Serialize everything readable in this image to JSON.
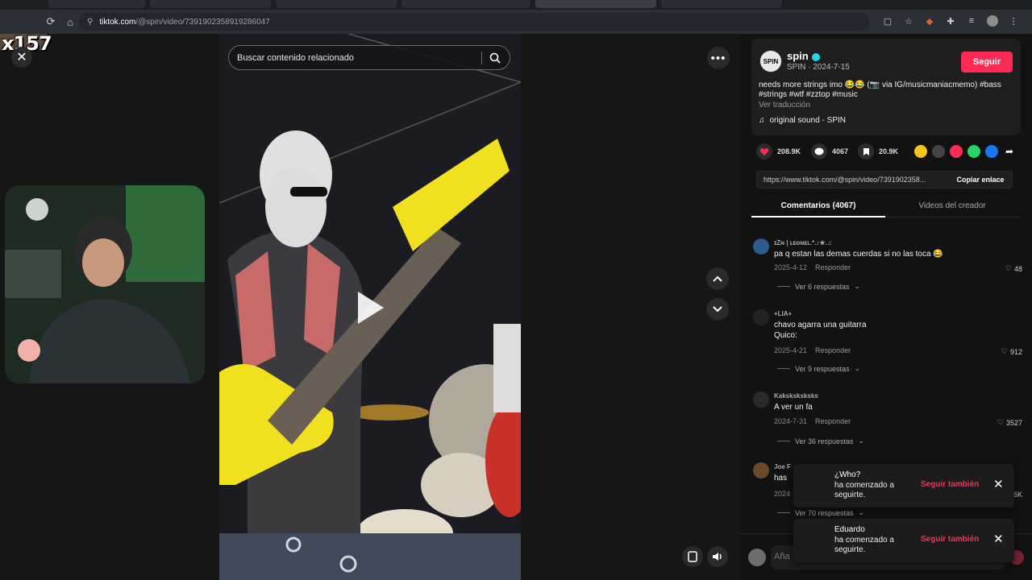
{
  "browser": {
    "url_host": "tiktok.com",
    "url_path": "/@spin/video/7391902358919286047"
  },
  "overlay": {
    "multiplier": "x157"
  },
  "search": {
    "placeholder": "Buscar contenido relacionado"
  },
  "post": {
    "username": "spin",
    "display_name_date": "SPIN · 2024-7-15",
    "follow_label": "Seguir",
    "avatar_text": "SPIN",
    "caption": "needs more strings imo 😂😂 (📷 via IG/musicmaniacmemo) #bass #strings #wtf #zztop #music",
    "see_translation": "Ver traducción",
    "sound": "original sound - SPIN",
    "likes": "208.9K",
    "comments_count": "4067",
    "saves": "20.9K",
    "link": "https://www.tiktok.com/@spin/video/7391902358...",
    "copy_link_label": "Copiar enlace"
  },
  "tabs": {
    "comments": "Comentarios (4067)",
    "creator_videos": "Videos del creador"
  },
  "comments": [
    {
      "user": "ɪZɴ | ʟᴇᴏɴᴇʟ.*.♪★.♫",
      "text": "pa q estan las demas cuerdas si no las toca 😂",
      "date": "2025-4-12",
      "reply": "Responder",
      "likes": "48",
      "replies": "Ver 6 respuestas"
    },
    {
      "user": "+LIA+",
      "text": "chavo agarra una guitarra Quico:",
      "date": "2025-4-21",
      "reply": "Responder",
      "likes": "912",
      "replies": "Ver 9 respuestas"
    },
    {
      "user": "Kaksksksksks",
      "text": "A ver un fa",
      "date": "2024-7-31",
      "reply": "Responder",
      "likes": "3527",
      "replies": "Ver 36 respuestas"
    },
    {
      "user": "Joe F",
      "text": "has",
      "date": "2024",
      "reply": "",
      "likes": "5.6K",
      "replies": "Ver 70 respuestas"
    }
  ],
  "composer": {
    "placeholder": "Aña"
  },
  "toasts": [
    {
      "name": "¿Who?",
      "message": "ha comenzado a seguirte.",
      "action": "Seguir también"
    },
    {
      "name": "Eduardo",
      "message": "ha comenzado a seguirte.",
      "action": "Seguir también"
    }
  ],
  "colors": {
    "accent": "#fe2c55",
    "verified": "#20d5ec",
    "guitar": "#f0e020"
  }
}
